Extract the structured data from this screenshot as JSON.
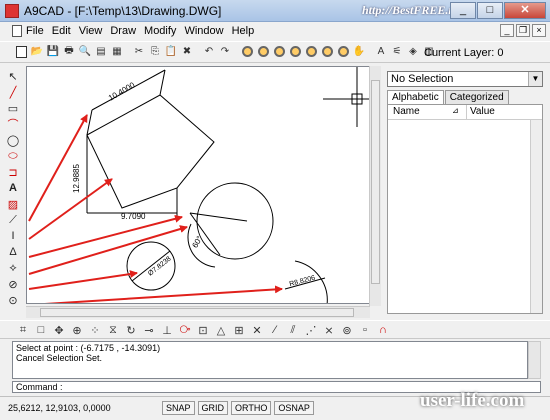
{
  "window": {
    "title": "A9CAD - [F:\\Temp\\13\\Drawing.DWG]",
    "watermark_top": "http://BestFREE.ru",
    "min": "_",
    "max": "□",
    "close": "✕"
  },
  "menubar": {
    "items": [
      "File",
      "Edit",
      "View",
      "Draw",
      "Modify",
      "Window",
      "Help"
    ],
    "mdi_min": "_",
    "mdi_restore": "❐",
    "mdi_close": "×"
  },
  "toolbar": {
    "current_layer_label": "Current Layer: 0"
  },
  "canvas": {
    "dimensions": [
      "10.4000",
      "12.9885",
      "9.7090",
      "60°",
      "Ø7.8238",
      "R8.8206"
    ],
    "arrow_color": "#e0201b",
    "dim_color": "#000000"
  },
  "properties": {
    "selection": "No Selection",
    "tabs": [
      "Alphabetic",
      "Categorized"
    ],
    "columns": [
      "Name",
      "Value"
    ]
  },
  "command": {
    "history": [
      "Select at point : (-6.7175 , -14.3091)",
      "Cancel Selection Set."
    ],
    "prompt": "Command :"
  },
  "status": {
    "coords": "25,6212, 12,9103, 0,0000",
    "buttons": [
      "SNAP",
      "GRID",
      "ORTHO",
      "OSNAP"
    ]
  },
  "watermark_bottom": "user-life.com"
}
